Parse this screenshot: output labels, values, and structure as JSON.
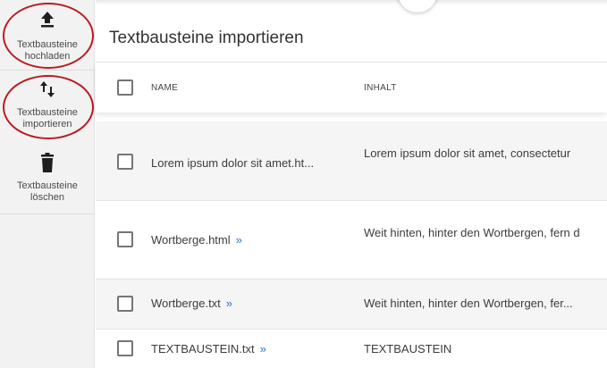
{
  "sidebar": {
    "items": [
      {
        "label_line1": "Textbausteine",
        "label_line2": "hochladen",
        "icon": "upload-icon"
      },
      {
        "label_line1": "Textbausteine",
        "label_line2": "importieren",
        "icon": "swap-vert-icon"
      },
      {
        "label_line1": "Textbausteine",
        "label_line2": "löschen",
        "icon": "trash-icon"
      }
    ],
    "highlight_color": "#b81c24"
  },
  "main": {
    "title": "Textbausteine importieren",
    "columns": {
      "name": "NAME",
      "content": "INHALT"
    },
    "rows": [
      {
        "name": "Lorem ipsum dolor sit amet.ht...",
        "chevron": "",
        "content": "Lorem ipsum dolor sit amet, consectetur"
      },
      {
        "name": "Wortberge.html",
        "chevron": "»",
        "content": "Weit hinten, hinter den Wortbergen, fern d"
      },
      {
        "name": "Wortberge.txt",
        "chevron": "»",
        "content": "Weit hinten, hinter den Wortbergen, fer..."
      },
      {
        "name": "TEXTBAUSTEIN.txt",
        "chevron": "»",
        "content": "TEXTBAUSTEIN"
      }
    ],
    "link_color": "#2f6fd0"
  }
}
